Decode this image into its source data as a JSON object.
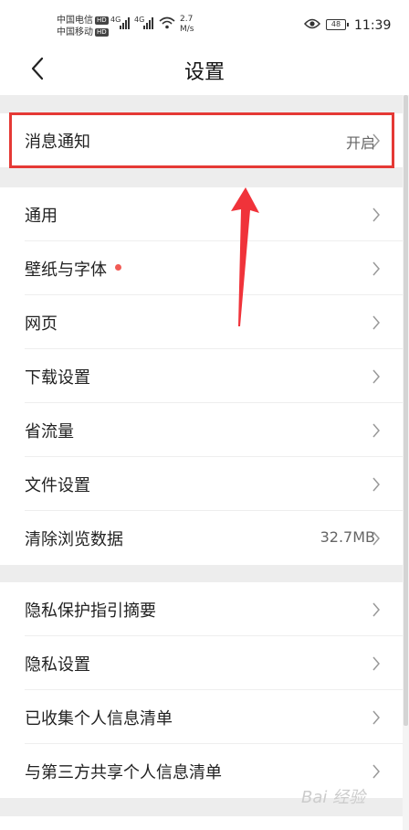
{
  "status_bar": {
    "carrier1": "中国电信",
    "carrier2": "中国移动",
    "hd": "HD",
    "net1": "4G",
    "net2": "4G",
    "speed_value": "2.7",
    "speed_unit": "M/s",
    "battery": "48",
    "time": "11:39"
  },
  "header": {
    "title": "设置"
  },
  "groups": [
    {
      "items": [
        {
          "label": "消息通知",
          "value": "开启"
        }
      ]
    },
    {
      "items": [
        {
          "label": "通用",
          "value": ""
        },
        {
          "label": "壁纸与字体",
          "value": ""
        },
        {
          "label": "网页",
          "value": ""
        },
        {
          "label": "下载设置",
          "value": ""
        },
        {
          "label": "省流量",
          "value": ""
        },
        {
          "label": "文件设置",
          "value": ""
        },
        {
          "label": "清除浏览数据",
          "value": "32.7MB"
        }
      ]
    },
    {
      "items": [
        {
          "label": "隐私保护指引摘要",
          "value": ""
        },
        {
          "label": "隐私设置",
          "value": ""
        },
        {
          "label": "已收集个人信息清单",
          "value": ""
        },
        {
          "label": "与第三方共享个人信息清单",
          "value": ""
        }
      ]
    }
  ],
  "colors": {
    "highlight": "#e53935",
    "badge": "#f15b55"
  },
  "watermark": "Bai 经验"
}
